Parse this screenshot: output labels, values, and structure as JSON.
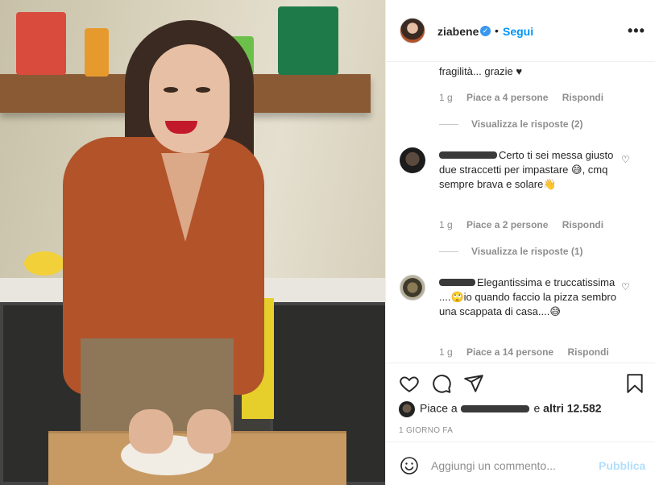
{
  "post": {
    "image_alt": "Photo of a smiling woman in an orange blouse kneading pizza dough in a kitchen"
  },
  "header": {
    "username": "ziabene",
    "verified_glyph": "✓",
    "separator": "•",
    "follow_label": "Segui",
    "more_glyph": "•••"
  },
  "comments": [
    {
      "text": "fragilità... grazie ♥",
      "time": "1 g",
      "likes": "Piace a 4 persone",
      "reply": "Rispondi",
      "view_replies": "Visualizza le risposte (2)",
      "show_avatar": false
    },
    {
      "text": "Certo ti sei messa giusto due straccetti per impastare 😅, cmq sempre brava e solare👋",
      "time": "1 g",
      "likes": "Piace a 2 persone",
      "reply": "Rispondi",
      "view_replies": "Visualizza le risposte (1)",
      "show_avatar": true
    },
    {
      "text": "Elegantissima e truccatissima ....🙄io quando faccio la pizza sembro una scappata di casa....😅",
      "time": "1 g",
      "likes": "Piace a 14 persone",
      "reply": "Rispondi",
      "show_avatar": true
    }
  ],
  "actions": {
    "heart_icon": "heart-icon",
    "comment_icon": "comment-icon",
    "share_icon": "share-icon",
    "save_icon": "bookmark-icon"
  },
  "likes": {
    "prefix": "Piace a",
    "suffix_joiner": "e",
    "others": "altri 12.582"
  },
  "timestamp": "1 GIORNO FA",
  "add_comment": {
    "placeholder": "Aggiungi un commento...",
    "publish_label": "Pubblica"
  },
  "colors": {
    "accent": "#0095f6",
    "publish_disabled": "#b2dffc",
    "muted": "#8e8e8e",
    "text": "#262626"
  }
}
